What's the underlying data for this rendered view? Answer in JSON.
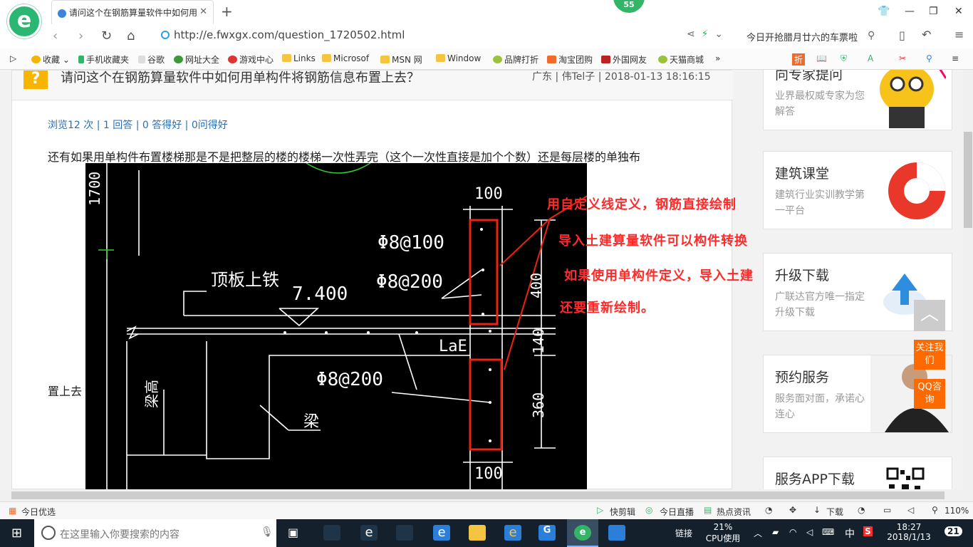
{
  "browser": {
    "tab_title": "请问这个在钢筋算量软件中如何用",
    "badge": "55",
    "url": "http://e.fwxgx.com/question_1720502.html",
    "search_text": "今日开抢腊月廿六的车票啦",
    "bookmarks": [
      "收藏",
      "手机收藏夹",
      "谷歌",
      "网址大全",
      "游戏中心",
      "Links",
      "Microsof",
      "MSN 网",
      "Window",
      "品牌打折",
      "淘宝团购",
      "外国网友",
      "天猫商城",
      "»"
    ],
    "ext_labels": [
      "折"
    ]
  },
  "question": {
    "title": "请问这个在钢筋算量软件中如何用单构件将钢筋信息布置上去？",
    "meta": "广东 | 伟Tel子 | 2018-01-13 18:16:15",
    "stats": "浏览12 次 | 1 回答 | 0 答得好 | 0问得好",
    "body": "还有如果用单构件布置楼梯那是不是把整层的楼的楼梯一次性弄完（这个一次性直接是加个个数）还是每层楼的单独布",
    "body_tail": "置上去"
  },
  "drawing": {
    "dims": [
      "100",
      "400",
      "140",
      "360",
      "100"
    ],
    "labels": [
      "Φ8@100",
      "Φ8@200",
      "Φ8@200",
      "顶板上铁",
      "7.400",
      "LaE",
      "梁高",
      "梁",
      "1700"
    ],
    "annotations": [
      "用自定义线定义，钢筋直接绘制",
      "导入土建算量软件可以构件转换",
      "如果使用单构件定义，导入土建",
      "还要重新绘制。"
    ]
  },
  "sidebar": {
    "cards": [
      {
        "title": "向专家提问",
        "sub": "业界最权威专家为您解答"
      },
      {
        "title": "建筑课堂",
        "sub": "建筑行业实训教学第一平台"
      },
      {
        "title": "升级下载",
        "sub": "广联达官方唯一指定升级下载"
      },
      {
        "title": "预约服务",
        "sub": "服务面对面，承诺心连心"
      },
      {
        "title": "服务APP下载",
        "sub": ""
      }
    ],
    "float_up": "︿",
    "float_follow": "关注我们",
    "float_qq": "QQ咨询"
  },
  "statusbar": {
    "left": "今日优选",
    "items": [
      "快剪辑",
      "今日直播",
      "热点资讯",
      "下载"
    ],
    "zoom": "110%"
  },
  "taskbar": {
    "search_placeholder": "在这里输入你要搜索的内容",
    "link_label": "链接",
    "cpu_pct": "21%",
    "cpu_label": "CPU使用",
    "ime": "中",
    "time": "18:27",
    "date": "2018/1/13",
    "notif_count": "21"
  },
  "colors": {
    "accent_green": "#33b469",
    "orange": "#ff6a00",
    "annot_red": "#ff2a2a",
    "link_blue": "#2c6fb6"
  }
}
